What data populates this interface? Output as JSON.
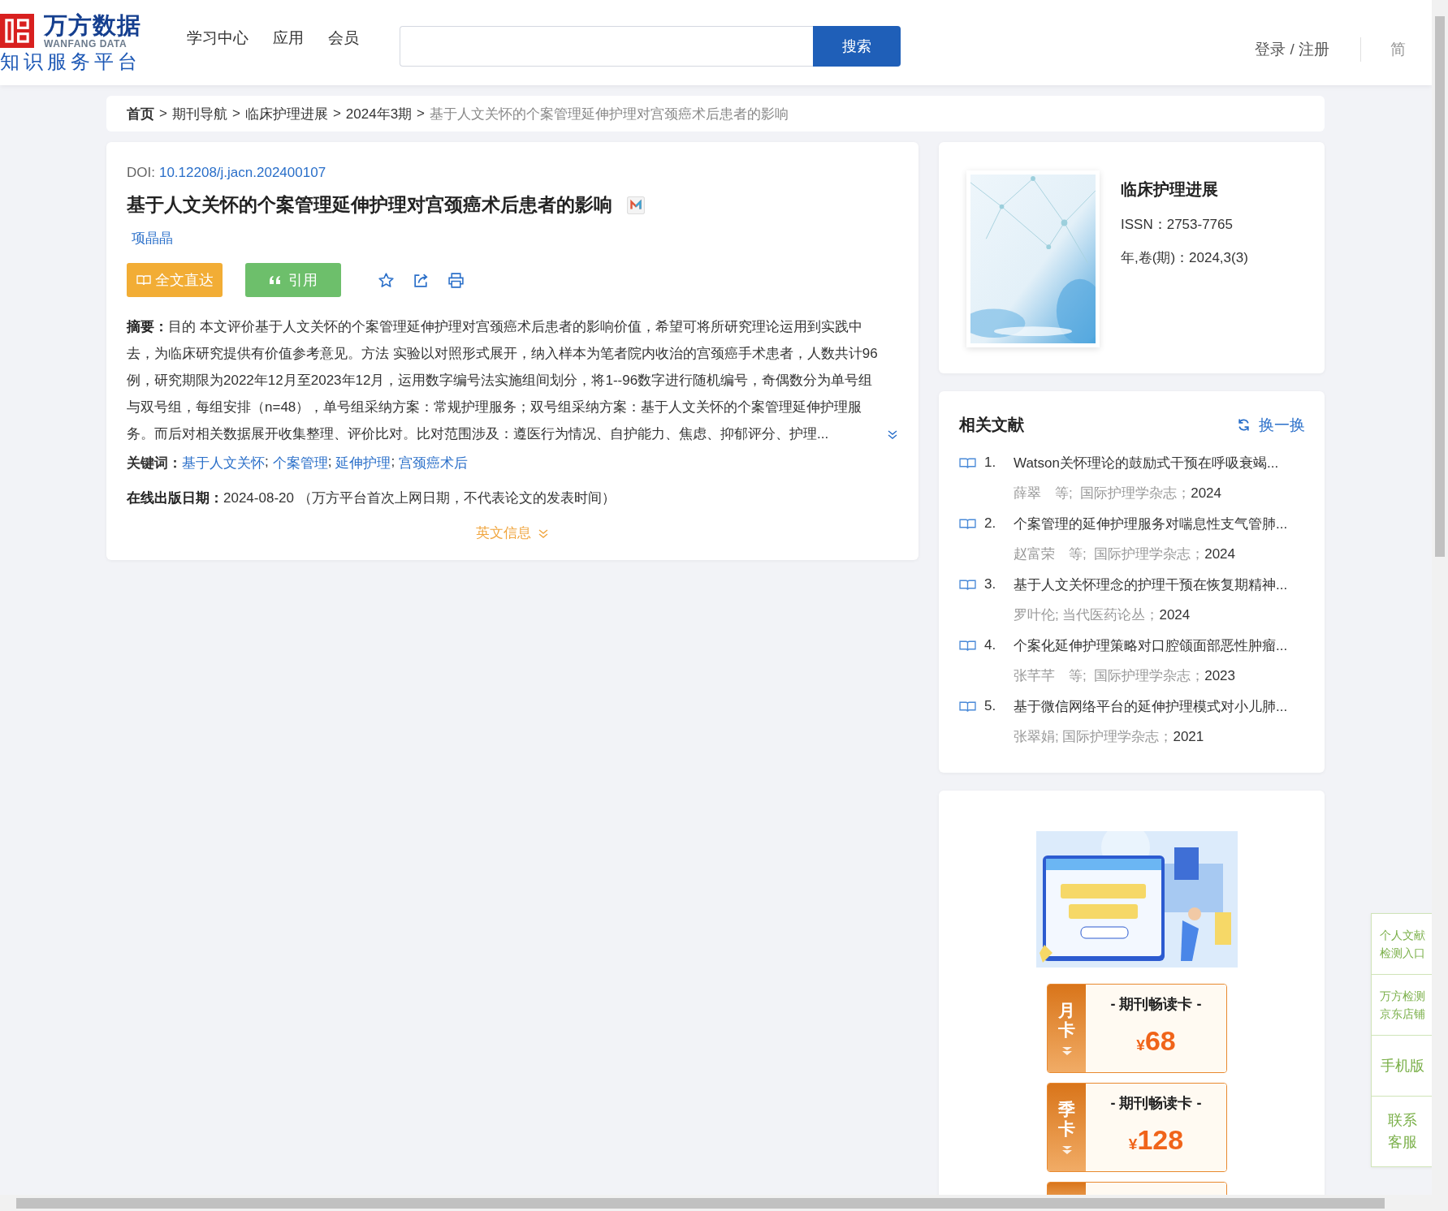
{
  "header": {
    "logo": {
      "name": "万方数据",
      "name_en": "WANFANG DATA",
      "tagline": "知识服务平台"
    },
    "nav": [
      "学习中心",
      "应用",
      "会员"
    ],
    "search": {
      "button": "搜索"
    },
    "login": "登录 / 注册",
    "language": "简"
  },
  "breadcrumb": {
    "separator": ">",
    "items": [
      {
        "label": "首页",
        "kind": "home"
      },
      {
        "label": "期刊导航",
        "kind": "link"
      },
      {
        "label": "临床护理进展",
        "kind": "link"
      },
      {
        "label": "2024年3期",
        "kind": "link"
      },
      {
        "label": "基于人文关怀的个案管理延伸护理对宫颈癌术后患者的影响",
        "kind": "current"
      }
    ]
  },
  "article": {
    "doi_label": "DOI:",
    "doi": "10.12208/j.jacn.202400107",
    "title": "基于人文关怀的个案管理延伸护理对宫颈癌术后患者的影响",
    "authors": [
      "项晶晶"
    ],
    "buttons": [
      {
        "kind": "fulltext",
        "label": "全文直达"
      },
      {
        "kind": "cite",
        "label": "引用"
      }
    ],
    "abstract": "**摘要：**目的 本文评价基于人文关怀的个案管理延伸护理对宫颈癌术后患者的影响价值，希望可将所研究理论运用到实践中去，为临床研究提供有价值参考意见。方法 实验以对照形式展开，纳入样本为笔者院内收治的宫颈癌手术患者，人数共计96例，研究期限为2022年12月至2023年12月，运用数字编号法实施组间划分，将1--96数字进行随机编号，奇偶数分为单号组与双号组，每组安排（n=48），单号组采纳方案：常规护理服务；双号组采纳方案：基于人文关怀的个案管理延伸护理服务。而后对相关数据展开收集整理、评价比对。比对范围涉及：遵医行为情况、自护能力、焦虑、抑郁评分、护理...",
    "keywords_label": "关键词：",
    "keywords": [
      "基于人文关怀",
      "个案管理",
      "延伸护理",
      "宫颈癌术后"
    ],
    "keyword_separator": ";",
    "online_date": "**在线出版日期：**2024-08-20 （万方平台首次上网日期，不代表论文的发表时间）",
    "english_toggle": "英文信息"
  },
  "journal": {
    "name": "临床护理进展",
    "issn": "ISSN：2753-7765",
    "issue": "年,卷(期)：2024,3(3)"
  },
  "related": {
    "title": "相关文献",
    "refresh": "换一换",
    "items": [
      {
        "number": "1.",
        "title": "Watson关怀理论的鼓励式干预在呼吸衰竭...",
        "meta": "薛翠　等;  国际护理学杂志；",
        "year": "2024"
      },
      {
        "number": "2.",
        "title": "个案管理的延伸护理服务对喘息性支气管肺...",
        "meta": "赵富荣　等;  国际护理学杂志；",
        "year": "2024"
      },
      {
        "number": "3.",
        "title": "基于人文关怀理念的护理干预在恢复期精神...",
        "meta": "罗叶伦; 当代医药论丛；",
        "year": "2024"
      },
      {
        "number": "4.",
        "title": "个案化延伸护理策略对口腔颌面部恶性肿瘤...",
        "meta": "张芊芊　等;  国际护理学杂志；",
        "year": "2023"
      },
      {
        "number": "5.",
        "title": "基于微信网络平台的延伸护理模式对小儿肺...",
        "meta": "张翠娟; 国际护理学杂志；",
        "year": "2021"
      }
    ]
  },
  "promo": {
    "cards": [
      {
        "kind": "card",
        "period": "月卡",
        "title": "- 期刊畅读卡 -",
        "currency": "¥",
        "price": "68"
      },
      {
        "kind": "card",
        "period": "季卡",
        "title": "- 期刊畅读卡 -",
        "currency": "¥",
        "price": "128"
      },
      {
        "kind": "cut"
      }
    ]
  },
  "side_panel": [
    {
      "label": "个人文献检测入口",
      "kind": "small"
    },
    {
      "label": "万方检测京东店铺",
      "kind": "small"
    },
    {
      "label": "手机版",
      "kind": "large"
    },
    {
      "label": "联系客服",
      "kind": "narrow"
    }
  ]
}
